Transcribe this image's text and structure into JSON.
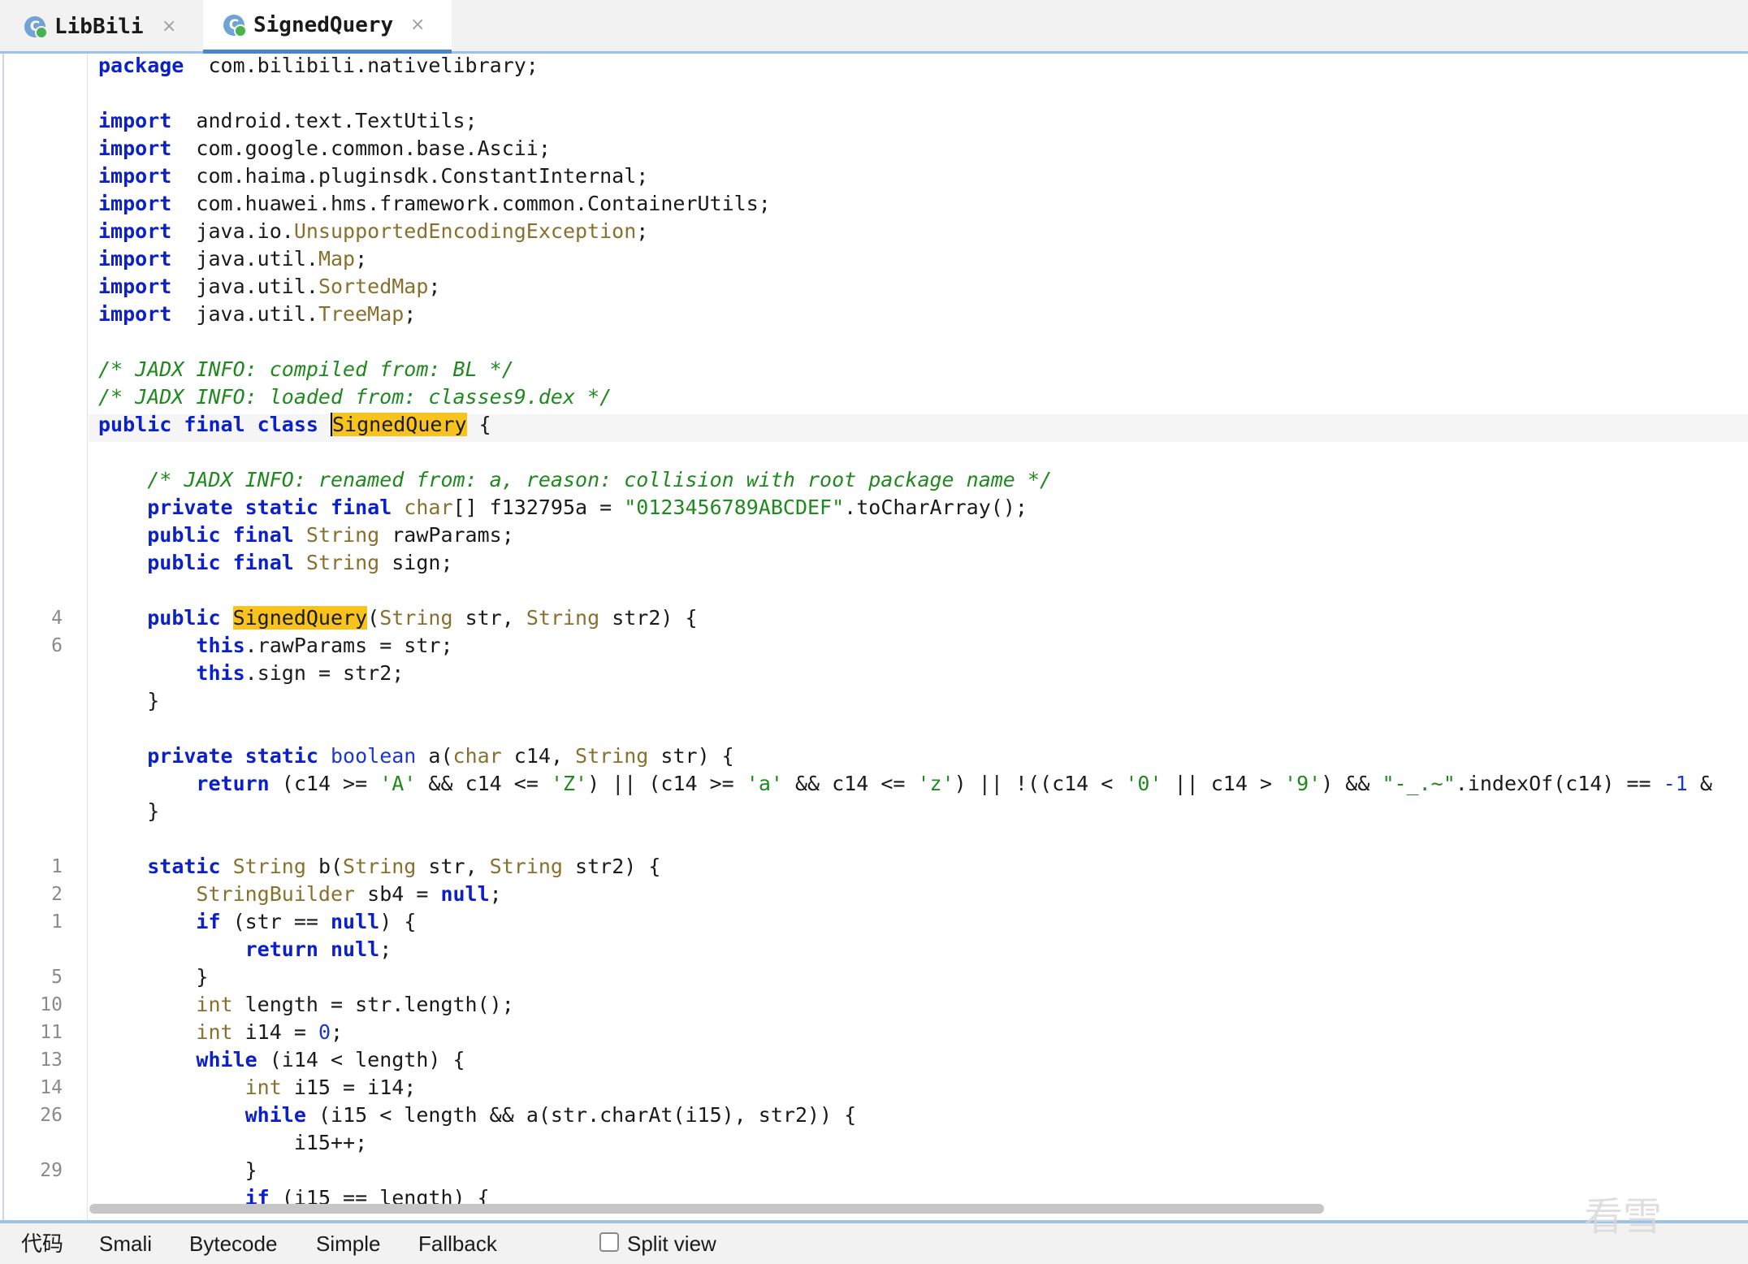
{
  "tabs": [
    {
      "icon_letter": "C",
      "label": "LibBili",
      "close": "×"
    },
    {
      "icon_letter": "C",
      "label": "SignedQuery",
      "close": "×"
    }
  ],
  "gutter_numbers": [
    {
      "line": 21,
      "num": "4"
    },
    {
      "line": 22,
      "num": "6"
    },
    {
      "line": 30,
      "num": "1"
    },
    {
      "line": 31,
      "num": "2"
    },
    {
      "line": 32,
      "num": "1"
    },
    {
      "line": 34,
      "num": "5"
    },
    {
      "line": 35,
      "num": "10"
    },
    {
      "line": 36,
      "num": "11"
    },
    {
      "line": 37,
      "num": "13"
    },
    {
      "line": 38,
      "num": "14"
    },
    {
      "line": 39,
      "num": "26"
    },
    {
      "line": 41,
      "num": "29"
    }
  ],
  "code_lines": [
    [
      [
        "kw",
        "package"
      ],
      [
        "",
        "  com.bilibili.nativelibrary;"
      ]
    ],
    [],
    [
      [
        "kw",
        "import"
      ],
      [
        "",
        "  android.text.TextUtils;"
      ]
    ],
    [
      [
        "kw",
        "import"
      ],
      [
        "",
        "  com.google.common.base.Ascii;"
      ]
    ],
    [
      [
        "kw",
        "import"
      ],
      [
        "",
        "  com.haima.pluginsdk.ConstantInternal;"
      ]
    ],
    [
      [
        "kw",
        "import"
      ],
      [
        "",
        "  com.huawei.hms.framework.common.ContainerUtils;"
      ]
    ],
    [
      [
        "kw",
        "import"
      ],
      [
        "",
        "  java.io."
      ],
      [
        "ty",
        "UnsupportedEncodingException"
      ],
      [
        "",
        ";"
      ]
    ],
    [
      [
        "kw",
        "import"
      ],
      [
        "",
        "  java.util."
      ],
      [
        "ty",
        "Map"
      ],
      [
        "",
        ";"
      ]
    ],
    [
      [
        "kw",
        "import"
      ],
      [
        "",
        "  java.util."
      ],
      [
        "ty",
        "SortedMap"
      ],
      [
        "",
        ";"
      ]
    ],
    [
      [
        "kw",
        "import"
      ],
      [
        "",
        "  java.util."
      ],
      [
        "ty",
        "TreeMap"
      ],
      [
        "",
        ";"
      ]
    ],
    [],
    [
      [
        "cm",
        "/* JADX INFO: compiled from: BL */"
      ]
    ],
    [
      [
        "cm",
        "/* JADX INFO: loaded from: classes9.dex */"
      ]
    ],
    [
      [
        "kw",
        "public final class "
      ],
      [
        "hlc",
        "SignedQuery"
      ],
      [
        "",
        " {"
      ]
    ],
    [],
    [
      [
        "",
        "    "
      ],
      [
        "cm",
        "/* JADX INFO: renamed from: a, reason: collision with root package name */"
      ]
    ],
    [
      [
        "",
        "    "
      ],
      [
        "kw",
        "private static final "
      ],
      [
        "ty",
        "char"
      ],
      [
        "",
        "[] f132795a = "
      ],
      [
        "st",
        "\"0123456789ABCDEF\""
      ],
      [
        "",
        ".toCharArray();"
      ]
    ],
    [
      [
        "",
        "    "
      ],
      [
        "kw",
        "public final "
      ],
      [
        "ty",
        "String"
      ],
      [
        "",
        " rawParams;"
      ]
    ],
    [
      [
        "",
        "    "
      ],
      [
        "kw",
        "public final "
      ],
      [
        "ty",
        "String"
      ],
      [
        "",
        " sign;"
      ]
    ],
    [],
    [
      [
        "",
        "    "
      ],
      [
        "kw",
        "public "
      ],
      [
        "hl",
        "SignedQuery"
      ],
      [
        "",
        "("
      ],
      [
        "ty",
        "String"
      ],
      [
        "",
        " str, "
      ],
      [
        "ty",
        "String"
      ],
      [
        "",
        " str2) {"
      ]
    ],
    [
      [
        "",
        "        "
      ],
      [
        "kw",
        "this"
      ],
      [
        "",
        ".rawParams = str;"
      ]
    ],
    [
      [
        "",
        "        "
      ],
      [
        "kw",
        "this"
      ],
      [
        "",
        ".sign = str2;"
      ]
    ],
    [
      [
        "",
        "    }"
      ]
    ],
    [],
    [
      [
        "",
        "    "
      ],
      [
        "kw",
        "private static "
      ],
      [
        "nm",
        "boolean"
      ],
      [
        "",
        " a("
      ],
      [
        "ty",
        "char"
      ],
      [
        "",
        " c14, "
      ],
      [
        "ty",
        "String"
      ],
      [
        "",
        " str) {"
      ]
    ],
    [
      [
        "",
        "        "
      ],
      [
        "kw",
        "return"
      ],
      [
        "",
        " (c14 >= "
      ],
      [
        "st",
        "'A'"
      ],
      [
        "",
        " && c14 <= "
      ],
      [
        "st",
        "'Z'"
      ],
      [
        "",
        ") || (c14 >= "
      ],
      [
        "st",
        "'a'"
      ],
      [
        "",
        " && c14 <= "
      ],
      [
        "st",
        "'z'"
      ],
      [
        "",
        ") || !((c14 < "
      ],
      [
        "st",
        "'0'"
      ],
      [
        "",
        " || c14 > "
      ],
      [
        "st",
        "'9'"
      ],
      [
        "",
        ") && "
      ],
      [
        "st",
        "\"-_.~\""
      ],
      [
        "",
        ".indexOf(c14) == "
      ],
      [
        "nm",
        "-1"
      ],
      [
        "",
        " &"
      ]
    ],
    [
      [
        "",
        "    }"
      ]
    ],
    [],
    [
      [
        "",
        "    "
      ],
      [
        "kw",
        "static "
      ],
      [
        "ty",
        "String"
      ],
      [
        "",
        " b("
      ],
      [
        "ty",
        "String"
      ],
      [
        "",
        " str, "
      ],
      [
        "ty",
        "String"
      ],
      [
        "",
        " str2) {"
      ]
    ],
    [
      [
        "",
        "        "
      ],
      [
        "ty",
        "StringBuilder"
      ],
      [
        "",
        " sb4 = "
      ],
      [
        "kw",
        "null"
      ],
      [
        "",
        ";"
      ]
    ],
    [
      [
        "",
        "        "
      ],
      [
        "kw",
        "if"
      ],
      [
        "",
        " (str == "
      ],
      [
        "kw",
        "null"
      ],
      [
        "",
        ") {"
      ]
    ],
    [
      [
        "",
        "            "
      ],
      [
        "kw",
        "return null"
      ],
      [
        "",
        ";"
      ]
    ],
    [
      [
        "",
        "        }"
      ]
    ],
    [
      [
        "",
        "        "
      ],
      [
        "ty",
        "int"
      ],
      [
        "",
        " length = str.length();"
      ]
    ],
    [
      [
        "",
        "        "
      ],
      [
        "ty",
        "int"
      ],
      [
        "",
        " i14 = "
      ],
      [
        "nm",
        "0"
      ],
      [
        "",
        ";"
      ]
    ],
    [
      [
        "",
        "        "
      ],
      [
        "kw",
        "while"
      ],
      [
        "",
        " (i14 < length) {"
      ]
    ],
    [
      [
        "",
        "            "
      ],
      [
        "ty",
        "int"
      ],
      [
        "",
        " i15 = i14;"
      ]
    ],
    [
      [
        "",
        "            "
      ],
      [
        "kw",
        "while"
      ],
      [
        "",
        " (i15 < length && a(str.charAt(i15), str2)) {"
      ]
    ],
    [
      [
        "",
        "                i15++;"
      ]
    ],
    [
      [
        "",
        "            }"
      ]
    ],
    [
      [
        "",
        "            "
      ],
      [
        "kw",
        "if"
      ],
      [
        "",
        " (i15 == length) {"
      ]
    ]
  ],
  "bottom_tabs": [
    "代码",
    "Smali",
    "Bytecode",
    "Simple",
    "Fallback"
  ],
  "split_view_label": "Split view",
  "watermark": "看雪"
}
